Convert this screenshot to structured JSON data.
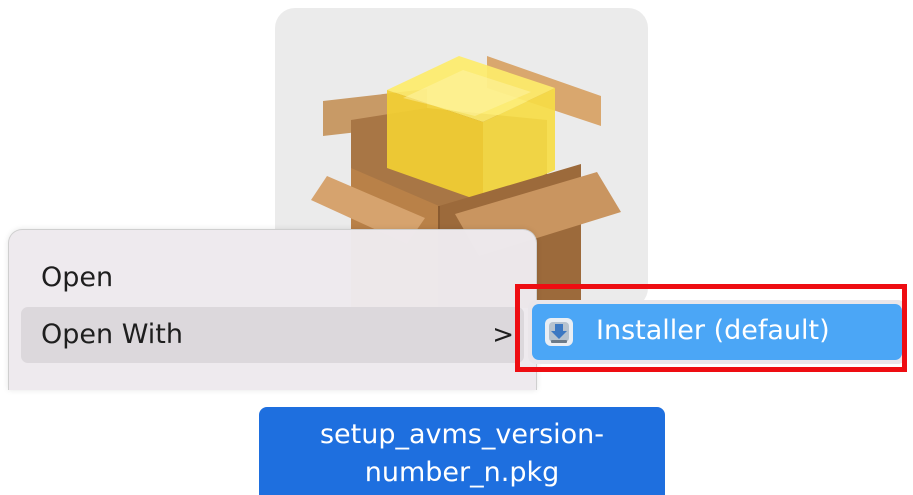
{
  "file": {
    "icon": "package-icon",
    "name_line1": "setup_avms_version-",
    "name_line2": "number_n.pkg"
  },
  "context_menu": {
    "items": [
      {
        "label": "Open"
      },
      {
        "label": "Open With",
        "chevron": ">"
      }
    ]
  },
  "submenu": {
    "items": [
      {
        "label": "Installer (default)",
        "icon": "installer-icon"
      }
    ]
  },
  "colors": {
    "selection_blue": "#4ba6f6",
    "file_label_blue": "#1e6fdf",
    "highlight_red": "#ee0d12",
    "menu_bg": "#eeeaee",
    "menu_hover": "#dcd8dc"
  }
}
